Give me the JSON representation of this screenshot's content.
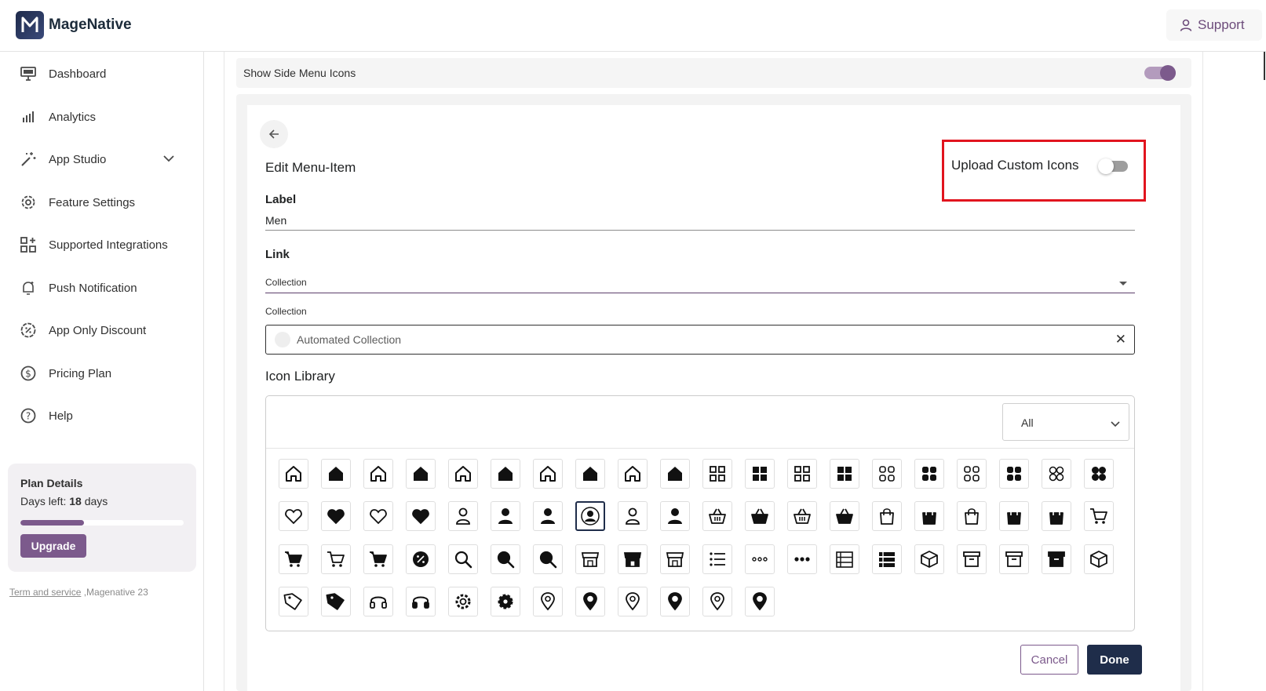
{
  "brand": {
    "name": "MageNative"
  },
  "header": {
    "support_label": "Support"
  },
  "sidebar": {
    "items": [
      {
        "label": "Dashboard",
        "icon": "monitor-icon"
      },
      {
        "label": "Analytics",
        "icon": "bar-chart-icon"
      },
      {
        "label": "App Studio",
        "icon": "magic-wand-icon",
        "expandable": true
      },
      {
        "label": "Feature Settings",
        "icon": "gear-icon"
      },
      {
        "label": "Supported Integrations",
        "icon": "apps-add-icon"
      },
      {
        "label": "Push Notification",
        "icon": "bell-icon"
      },
      {
        "label": "App Only Discount",
        "icon": "discount-badge-icon"
      },
      {
        "label": "Pricing Plan",
        "icon": "dollar-circle-icon"
      },
      {
        "label": "Help",
        "icon": "help-circle-icon"
      }
    ],
    "plan": {
      "title": "Plan Details",
      "days_prefix": "Days left: ",
      "days_value": "18",
      "days_suffix": " days",
      "progress_fraction": 0.39,
      "upgrade_label": "Upgrade"
    },
    "footer": {
      "link_text": "Term and service",
      "suffix": " ,Magenative 23"
    }
  },
  "main": {
    "side_menu_icons": {
      "label": "Show Side Menu Icons",
      "enabled": true
    },
    "edit": {
      "title": "Edit Menu-Item",
      "upload_custom_icons": {
        "label": "Upload Custom Icons",
        "enabled": false
      },
      "label_field": {
        "label": "Label",
        "value": "Men"
      },
      "link_field": {
        "label": "Link",
        "value": "Collection"
      },
      "collection_field": {
        "label": "Collection",
        "value": "Automated Collection"
      },
      "icon_library": {
        "title": "Icon Library",
        "filter_value": "All",
        "selected_icon": "person-circle-filled-icon",
        "rows": [
          [
            "home-outline-icon",
            "home-filled-icon",
            "home-outline-icon",
            "home-filled-icon",
            "home-outline-icon",
            "home-filled-icon",
            "home-outline-icon",
            "home-filled-icon",
            "home-outline-icon",
            "home-filled-icon",
            "grid-outline-icon",
            "grid-filled-icon",
            "grid-outline-icon",
            "grid-filled-icon",
            "grid-rounded-outline-icon",
            "grid-rounded-filled-icon",
            "grid-rounded-outline-icon",
            "grid-rounded-filled-icon",
            "circles-outline-icon",
            "circles-filled-icon"
          ],
          [
            "heart-outline-icon",
            "heart-filled-icon",
            "heart-outline-icon",
            "heart-filled-icon",
            "person-outline-icon",
            "person-filled-icon",
            "person-filled-icon",
            "person-circle-filled-icon",
            "person-outline-icon",
            "person-filled-icon",
            "basket-outline-icon",
            "basket-filled-icon",
            "basket-outline-icon",
            "basket-filled-icon",
            "bag-outline-icon",
            "bag-filled-icon",
            "bag-outline-icon",
            "bag-filled-icon",
            "bag-filled-icon",
            "cart-outline-icon"
          ],
          [
            "cart-filled-icon",
            "cart-outline-icon",
            "cart-filled-icon",
            "discount-badge-icon",
            "search-outline-icon",
            "search-filled-icon",
            "search-filled-icon",
            "store-outline-icon",
            "store-filled-icon",
            "store-outline-icon",
            "list-icon",
            "more-dots-outline-icon",
            "more-dots-filled-icon",
            "list-outline-icon",
            "list-filled-icon",
            "box-outline-icon",
            "archive-outline-icon",
            "archive-outline-icon",
            "archive-filled-icon",
            "box-outline-icon"
          ],
          [
            "tag-outline-icon",
            "tag-filled-icon",
            "headset-outline-icon",
            "headset-filled-icon",
            "gear-outline-icon",
            "gear-filled-icon",
            "location-outline-icon",
            "location-filled-icon",
            "location-outline-icon",
            "location-filled-icon",
            "location-outline-icon",
            "location-filled-icon"
          ]
        ]
      },
      "actions": {
        "cancel_label": "Cancel",
        "done_label": "Done"
      }
    }
  },
  "colors": {
    "accent": "#7c5a8c",
    "primary_dark": "#1f2d4a",
    "highlight_red": "#e1141e"
  }
}
